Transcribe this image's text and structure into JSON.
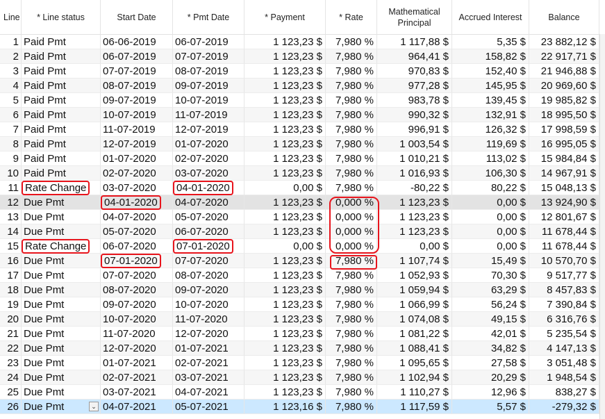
{
  "headers": {
    "line": "Line",
    "status": "* Line status",
    "start": "Start Date",
    "pmt": "* Pmt Date",
    "payment": "* Payment",
    "rate": "* Rate",
    "math": "Mathematical\nPrincipal",
    "accrued": "Accrued Interest",
    "balance": "Balance"
  },
  "rows": [
    {
      "line": "1",
      "status": "Paid Pmt",
      "start": "06-06-2019",
      "pmt": "06-07-2019",
      "payment": "1 123,23 $",
      "rate": "7,980 %",
      "math": "1 117,88 $",
      "accrued": "5,35 $",
      "balance": "23 882,12 $"
    },
    {
      "line": "2",
      "status": "Paid Pmt",
      "start": "06-07-2019",
      "pmt": "07-07-2019",
      "payment": "1 123,23 $",
      "rate": "7,980 %",
      "math": "964,41 $",
      "accrued": "158,82 $",
      "balance": "22 917,71 $"
    },
    {
      "line": "3",
      "status": "Paid Pmt",
      "start": "07-07-2019",
      "pmt": "08-07-2019",
      "payment": "1 123,23 $",
      "rate": "7,980 %",
      "math": "970,83 $",
      "accrued": "152,40 $",
      "balance": "21 946,88 $"
    },
    {
      "line": "4",
      "status": "Paid Pmt",
      "start": "08-07-2019",
      "pmt": "09-07-2019",
      "payment": "1 123,23 $",
      "rate": "7,980 %",
      "math": "977,28 $",
      "accrued": "145,95 $",
      "balance": "20 969,60 $"
    },
    {
      "line": "5",
      "status": "Paid Pmt",
      "start": "09-07-2019",
      "pmt": "10-07-2019",
      "payment": "1 123,23 $",
      "rate": "7,980 %",
      "math": "983,78 $",
      "accrued": "139,45 $",
      "balance": "19 985,82 $"
    },
    {
      "line": "6",
      "status": "Paid Pmt",
      "start": "10-07-2019",
      "pmt": "11-07-2019",
      "payment": "1 123,23 $",
      "rate": "7,980 %",
      "math": "990,32 $",
      "accrued": "132,91 $",
      "balance": "18 995,50 $"
    },
    {
      "line": "7",
      "status": "Paid Pmt",
      "start": "11-07-2019",
      "pmt": "12-07-2019",
      "payment": "1 123,23 $",
      "rate": "7,980 %",
      "math": "996,91 $",
      "accrued": "126,32 $",
      "balance": "17 998,59 $"
    },
    {
      "line": "8",
      "status": "Paid Pmt",
      "start": "12-07-2019",
      "pmt": "01-07-2020",
      "payment": "1 123,23 $",
      "rate": "7,980 %",
      "math": "1 003,54 $",
      "accrued": "119,69 $",
      "balance": "16 995,05 $"
    },
    {
      "line": "9",
      "status": "Paid Pmt",
      "start": "01-07-2020",
      "pmt": "02-07-2020",
      "payment": "1 123,23 $",
      "rate": "7,980 %",
      "math": "1 010,21 $",
      "accrued": "113,02 $",
      "balance": "15 984,84 $"
    },
    {
      "line": "10",
      "status": "Paid Pmt",
      "start": "02-07-2020",
      "pmt": "03-07-2020",
      "payment": "1 123,23 $",
      "rate": "7,980 %",
      "math": "1 016,93 $",
      "accrued": "106,30 $",
      "balance": "14 967,91 $"
    },
    {
      "line": "11",
      "status": "Rate Change",
      "start": "03-07-2020",
      "pmt": "04-01-2020",
      "payment": "0,00 $",
      "rate": "7,980 %",
      "math": "-80,22 $",
      "accrued": "80,22 $",
      "balance": "15 048,13 $"
    },
    {
      "line": "12",
      "status": "Due Pmt",
      "start": "04-01-2020",
      "pmt": "04-07-2020",
      "payment": "1 123,23 $",
      "rate": "0,000 %",
      "math": "1 123,23 $",
      "accrued": "0,00 $",
      "balance": "13 924,90 $"
    },
    {
      "line": "13",
      "status": "Due Pmt",
      "start": "04-07-2020",
      "pmt": "05-07-2020",
      "payment": "1 123,23 $",
      "rate": "0,000 %",
      "math": "1 123,23 $",
      "accrued": "0,00 $",
      "balance": "12 801,67 $"
    },
    {
      "line": "14",
      "status": "Due Pmt",
      "start": "05-07-2020",
      "pmt": "06-07-2020",
      "payment": "1 123,23 $",
      "rate": "0,000 %",
      "math": "1 123,23 $",
      "accrued": "0,00 $",
      "balance": "11 678,44 $"
    },
    {
      "line": "15",
      "status": "Rate Change",
      "start": "06-07-2020",
      "pmt": "07-01-2020",
      "payment": "0,00 $",
      "rate": "0,000 %",
      "math": "0,00 $",
      "accrued": "0,00 $",
      "balance": "11 678,44 $"
    },
    {
      "line": "16",
      "status": "Due Pmt",
      "start": "07-01-2020",
      "pmt": "07-07-2020",
      "payment": "1 123,23 $",
      "rate": "7,980 %",
      "math": "1 107,74 $",
      "accrued": "15,49 $",
      "balance": "10 570,70 $"
    },
    {
      "line": "17",
      "status": "Due Pmt",
      "start": "07-07-2020",
      "pmt": "08-07-2020",
      "payment": "1 123,23 $",
      "rate": "7,980 %",
      "math": "1 052,93 $",
      "accrued": "70,30 $",
      "balance": "9 517,77 $"
    },
    {
      "line": "18",
      "status": "Due Pmt",
      "start": "08-07-2020",
      "pmt": "09-07-2020",
      "payment": "1 123,23 $",
      "rate": "7,980 %",
      "math": "1 059,94 $",
      "accrued": "63,29 $",
      "balance": "8 457,83 $"
    },
    {
      "line": "19",
      "status": "Due Pmt",
      "start": "09-07-2020",
      "pmt": "10-07-2020",
      "payment": "1 123,23 $",
      "rate": "7,980 %",
      "math": "1 066,99 $",
      "accrued": "56,24 $",
      "balance": "7 390,84 $"
    },
    {
      "line": "20",
      "status": "Due Pmt",
      "start": "10-07-2020",
      "pmt": "11-07-2020",
      "payment": "1 123,23 $",
      "rate": "7,980 %",
      "math": "1 074,08 $",
      "accrued": "49,15 $",
      "balance": "6 316,76 $"
    },
    {
      "line": "21",
      "status": "Due Pmt",
      "start": "11-07-2020",
      "pmt": "12-07-2020",
      "payment": "1 123,23 $",
      "rate": "7,980 %",
      "math": "1 081,22 $",
      "accrued": "42,01 $",
      "balance": "5 235,54 $"
    },
    {
      "line": "22",
      "status": "Due Pmt",
      "start": "12-07-2020",
      "pmt": "01-07-2021",
      "payment": "1 123,23 $",
      "rate": "7,980 %",
      "math": "1 088,41 $",
      "accrued": "34,82 $",
      "balance": "4 147,13 $"
    },
    {
      "line": "23",
      "status": "Due Pmt",
      "start": "01-07-2021",
      "pmt": "02-07-2021",
      "payment": "1 123,23 $",
      "rate": "7,980 %",
      "math": "1 095,65 $",
      "accrued": "27,58 $",
      "balance": "3 051,48 $"
    },
    {
      "line": "24",
      "status": "Due Pmt",
      "start": "02-07-2021",
      "pmt": "03-07-2021",
      "payment": "1 123,23 $",
      "rate": "7,980 %",
      "math": "1 102,94 $",
      "accrued": "20,29 $",
      "balance": "1 948,54 $"
    },
    {
      "line": "25",
      "status": "Due Pmt",
      "start": "03-07-2021",
      "pmt": "04-07-2021",
      "payment": "1 123,23 $",
      "rate": "7,980 %",
      "math": "1 110,27 $",
      "accrued": "12,96 $",
      "balance": "838,27 $"
    },
    {
      "line": "26",
      "status": "Due Pmt",
      "start": "04-07-2021",
      "pmt": "05-07-2021",
      "payment": "1 123,16 $",
      "rate": "7,980 %",
      "math": "1 117,59 $",
      "accrued": "5,57 $",
      "balance": "-279,32 $"
    }
  ],
  "highlight_color": "#e8141c",
  "selected_row_color": "#cce8ff",
  "current_row_color": "#e3e3e3",
  "dropdown_icon": "chevron-down-icon"
}
